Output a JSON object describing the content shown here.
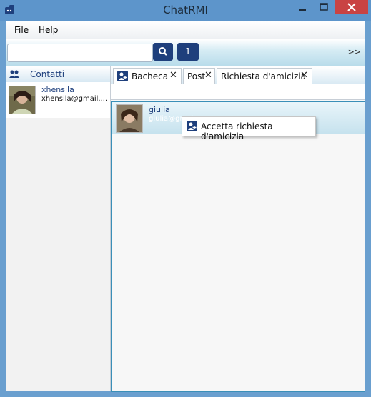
{
  "window": {
    "title": "ChatRMI"
  },
  "menu": {
    "items": [
      "File",
      "Help"
    ]
  },
  "toolbar": {
    "search_value": "",
    "friend_requests_count": "1",
    "more_label": ">>"
  },
  "contacts": {
    "header": "Contatti",
    "items": [
      {
        "name": "xhensila",
        "email": "xhensila@gmail...."
      }
    ]
  },
  "tabs": [
    {
      "label": "Bacheca"
    },
    {
      "label": "Post"
    },
    {
      "label": "Richiesta d'amicizia"
    }
  ],
  "requests": [
    {
      "name": "giulia",
      "email": "giulia@gmai"
    }
  ],
  "context_menu": {
    "items": [
      "Accetta richiesta d'amicizia"
    ]
  },
  "icons": {
    "app": "chat-puzzle-icon",
    "contacts": "users-icon",
    "search": "search-icon",
    "add": "add-user-icon",
    "close": "close-icon"
  },
  "colors": {
    "accent": "#1e3f7c",
    "window": "#5d95cb",
    "close": "#c94343",
    "selection": "#3a8fb8"
  }
}
